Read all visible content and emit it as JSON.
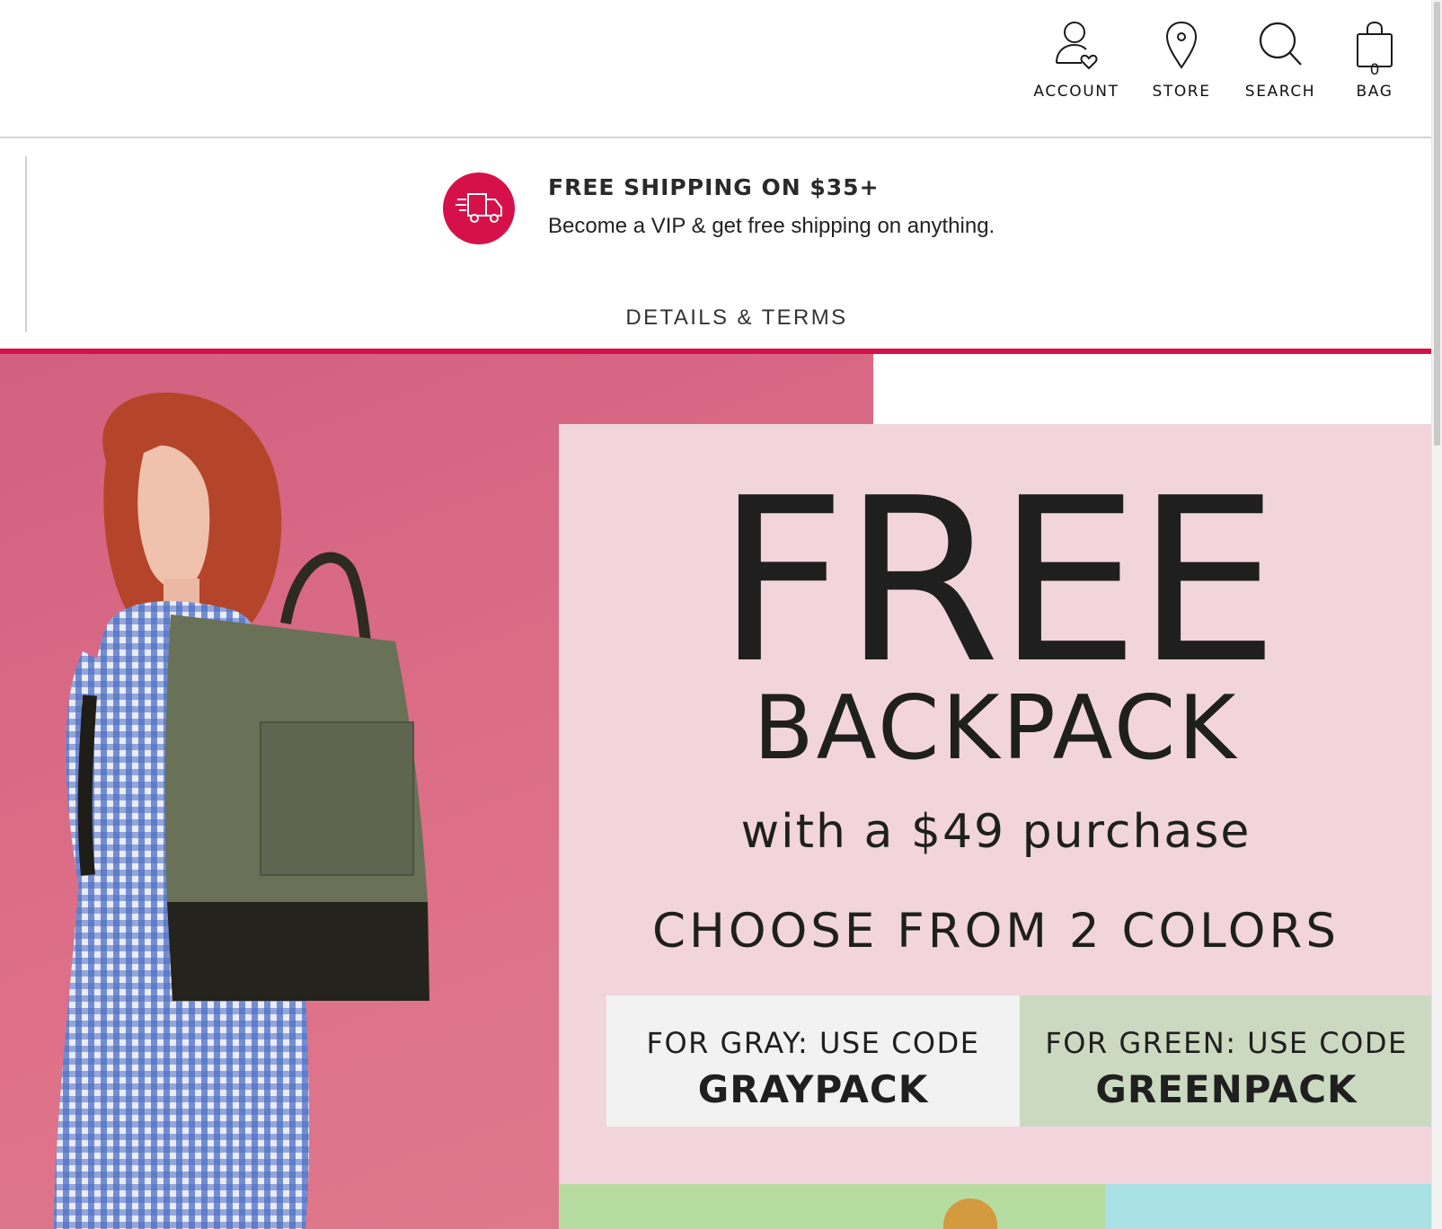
{
  "header": {
    "nav": [
      {
        "label": "ACCOUNT",
        "icon": "account-icon"
      },
      {
        "label": "STORE",
        "icon": "location-pin-icon"
      },
      {
        "label": "SEARCH",
        "icon": "search-icon"
      },
      {
        "label": "BAG",
        "icon": "shopping-bag-icon"
      }
    ],
    "bag_count": "0"
  },
  "promo": {
    "title": "FREE SHIPPING ON $35+",
    "subtitle": "Become a VIP & get free shipping on anything.",
    "details_link": "DETAILS & TERMS",
    "icon": "delivery-truck-icon",
    "accent_color": "#d6114a"
  },
  "hero": {
    "headline": "FREE",
    "product": "BACKPACK",
    "condition": "with a $49 purchase",
    "choose": "CHOOSE FROM 2 COLORS",
    "codes": [
      {
        "label": "FOR GRAY: USE CODE",
        "code": "GRAYPACK",
        "color": "#f2f2f2"
      },
      {
        "label": "FOR GREEN: USE CODE",
        "code": "GREENPACK",
        "color": "#cbd9c1"
      }
    ],
    "card_color": "#f2d5dc",
    "photo_bg_color": "#d96a86"
  }
}
